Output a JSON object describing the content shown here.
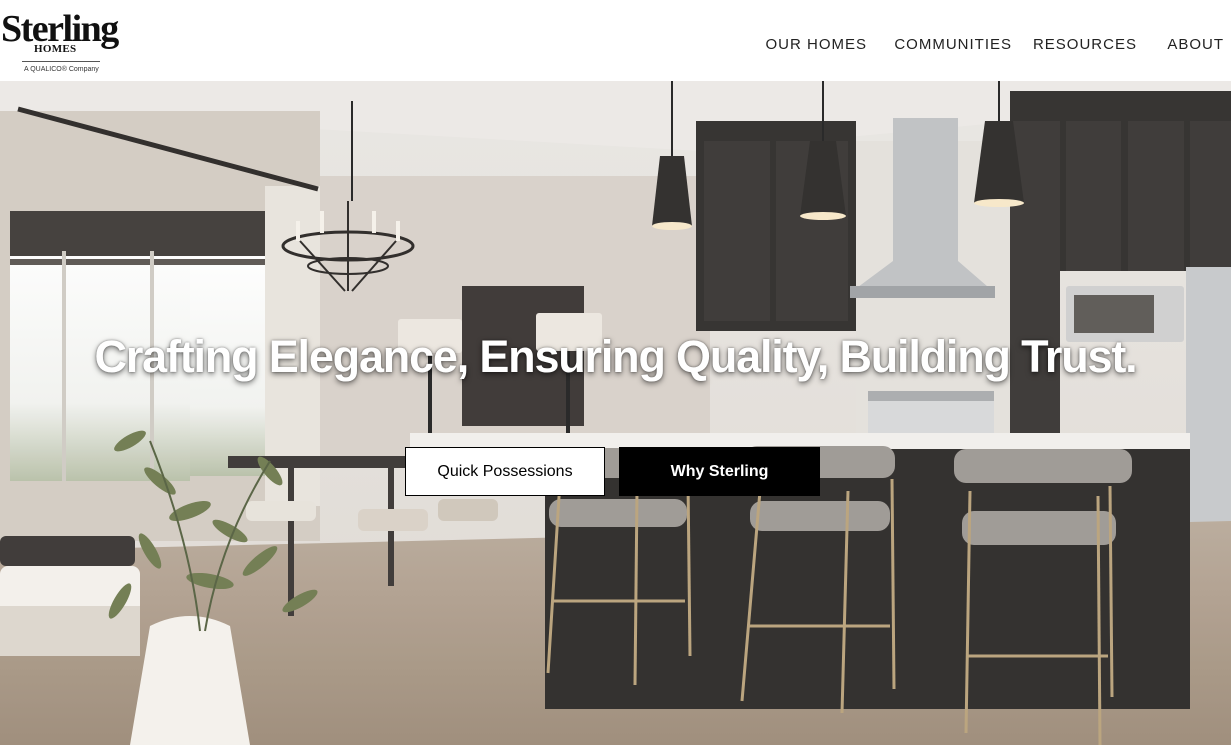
{
  "header": {
    "logo": {
      "name": "Sterling",
      "sub": "HOMES",
      "tagline": "A QUALICO® Company"
    },
    "nav": [
      {
        "label": "OUR HOMES"
      },
      {
        "label": "COMMUNITIES"
      },
      {
        "label": "RESOURCES"
      },
      {
        "label": "ABOUT"
      }
    ]
  },
  "hero": {
    "image_description": "kitchen-interior-photo",
    "headline": "Crafting Elegance, Ensuring Quality, Building Trust.",
    "buttons": {
      "quick_possessions": "Quick Possessions",
      "why_sterling": "Why Sterling"
    }
  },
  "colors": {
    "button_primary_bg": "#000000",
    "button_secondary_bg": "#ffffff",
    "headline_text": "#ffffff"
  }
}
